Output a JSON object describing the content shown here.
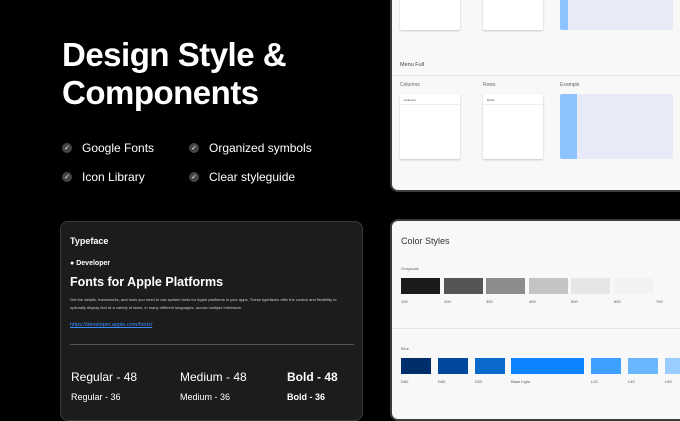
{
  "hero": {
    "title_line1": "Design Style &",
    "title_line2": "Components",
    "features": [
      {
        "label": "Google Fonts",
        "icon": "check-icon"
      },
      {
        "label": "Organized symbols",
        "icon": "check-icon"
      },
      {
        "label": "Icon Library",
        "icon": "check-icon"
      },
      {
        "label": "Clear styleguide",
        "icon": "check-icon"
      }
    ]
  },
  "typeface": {
    "heading": "Typeface",
    "brand": "Developer",
    "title": "Fonts for Apple Platforms",
    "description": "Get the details, frameworks, and tools you need to use system fonts for Apple platforms in your apps. These typefaces offer the control and flexibility to optimally display text at a variety of sizes, in many different languages, across multiple interfaces.",
    "link": "https://developer.apple.com/fonts/",
    "samples": [
      [
        "Regular - 48",
        "Medium - 48",
        "Bold - 48"
      ],
      [
        "Regular - 36",
        "Medium - 36",
        "Bold - 36"
      ]
    ]
  },
  "grid": {
    "section": "Menu Full",
    "columns_label": "Columns",
    "rows_label": "Rows",
    "example_label": "Example",
    "columns_select": "Columns",
    "rows_select": "Rows"
  },
  "colors": {
    "title": "Color Styles",
    "grayscale_label": "Grayscale",
    "grayscale": [
      {
        "name": "100",
        "hex": "#1A1A1A"
      },
      {
        "name": "200",
        "hex": "#555555"
      },
      {
        "name": "300",
        "hex": "#8C8C8C"
      },
      {
        "name": "400",
        "hex": "#C4C4C4"
      },
      {
        "name": "500",
        "hex": "#E6E6E6"
      },
      {
        "name": "600",
        "hex": "#F2F2F2"
      },
      {
        "name": "700",
        "hex": "#F8F8F8"
      }
    ],
    "blue_label": "Blue",
    "blue": [
      {
        "name": "D60",
        "hex": "#002E6B"
      },
      {
        "name": "D40",
        "hex": "#00479E"
      },
      {
        "name": "D20",
        "hex": "#0A6ACC"
      },
      {
        "name": "Base Light",
        "hex": "#0A84FF"
      },
      {
        "name": "L20",
        "hex": "#3BA0FF"
      },
      {
        "name": "L40",
        "hex": "#6AB7FF"
      },
      {
        "name": "L60",
        "hex": "#9ACDFF"
      }
    ]
  }
}
